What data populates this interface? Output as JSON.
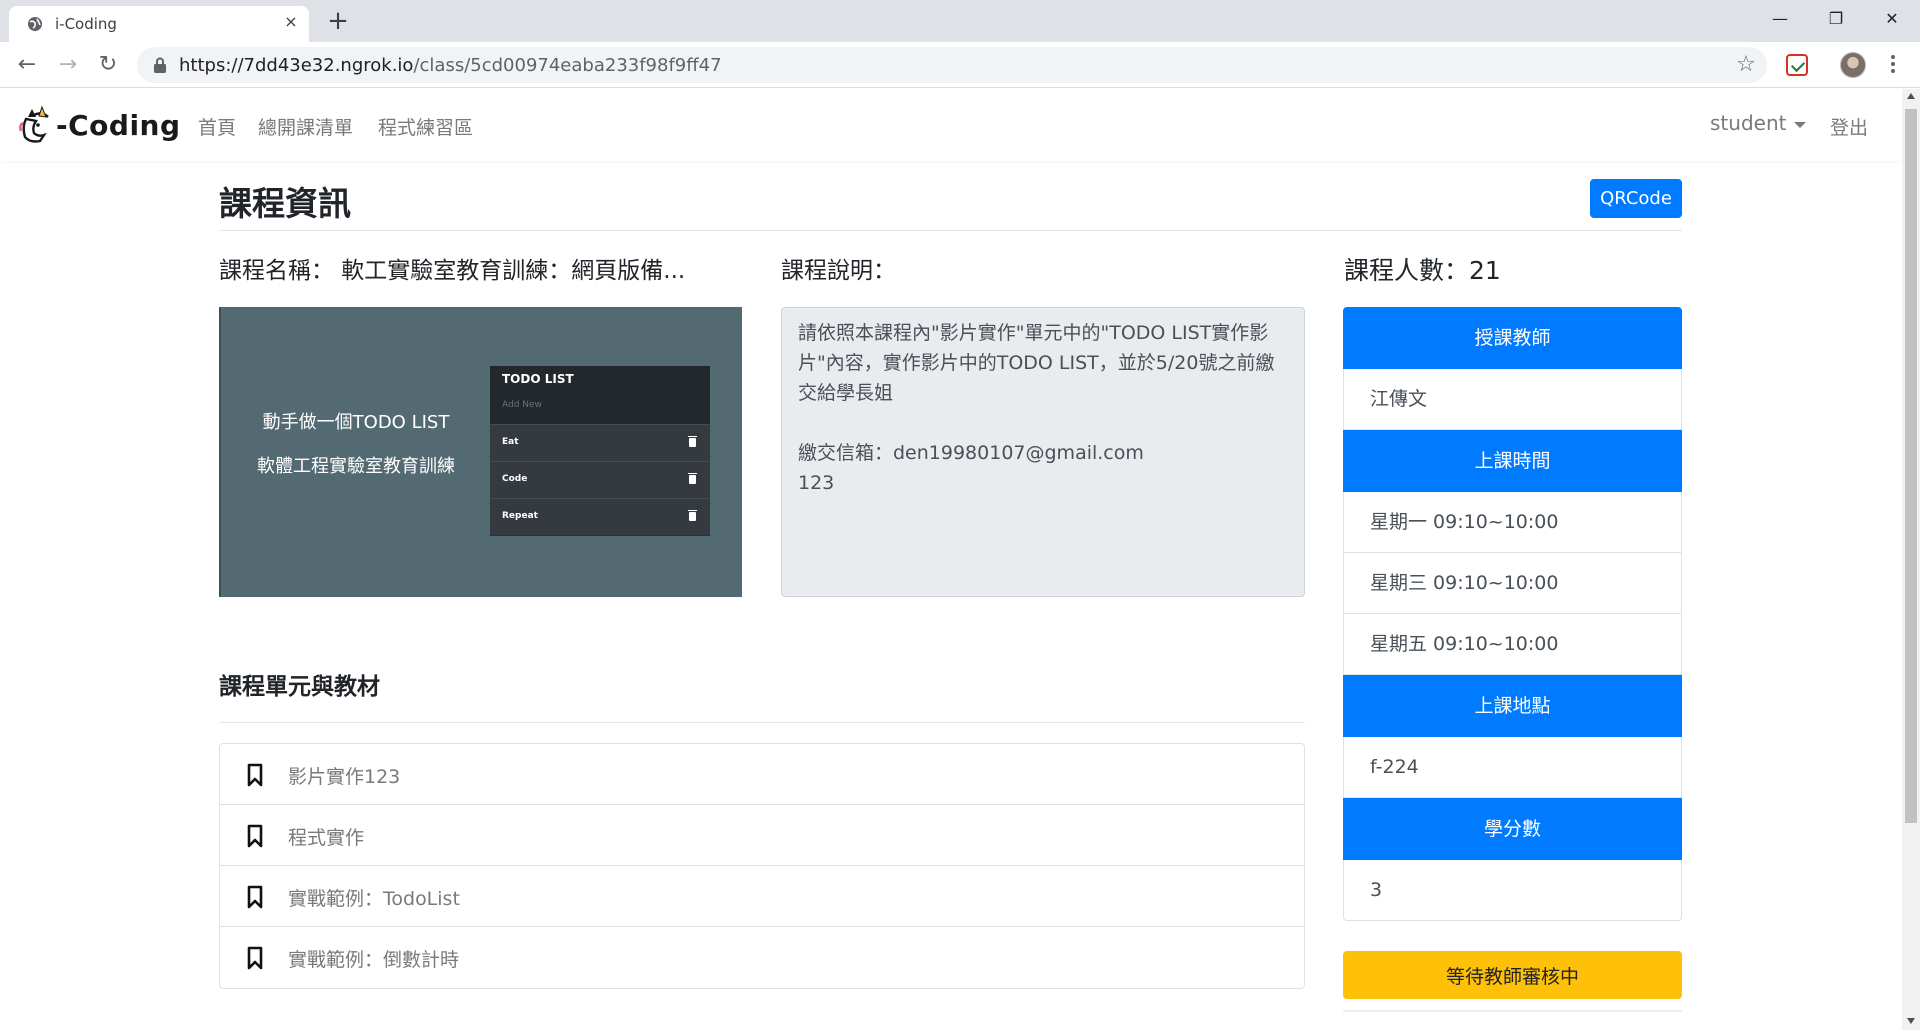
{
  "browser": {
    "tab_title": "i-Coding",
    "tab_close": "×",
    "new_tab": "+",
    "url_host": "https://7dd43e32.ngrok.io",
    "url_path": "/class/5cd00974eaba233f98f9ff47",
    "window_controls": {
      "minimize": "—",
      "maximize": "❐",
      "close": "✕"
    },
    "nav": {
      "back": "←",
      "forward": "→",
      "reload": "↻"
    },
    "star": "☆"
  },
  "navbar": {
    "brand": "-Coding",
    "links": [
      "首頁",
      "總開課清單",
      "程式練習區"
    ],
    "user": "student",
    "logout": "登出"
  },
  "header": {
    "title": "課程資訊",
    "qrcode_button": "QRCode"
  },
  "course": {
    "name_label": "課程名稱： 軟工實驗室教育訓練：網頁版備...",
    "desc_label": "課程說明：",
    "count_label": "課程人數：21",
    "image": {
      "line1": "動手做一個TODO LIST",
      "line2": "軟體工程實驗室教育訓練",
      "todo_title": "TODO LIST",
      "todo_placeholder": "Add New",
      "todo_items": [
        "Eat",
        "Code",
        "Repeat"
      ]
    },
    "description": {
      "paragraph1": "請依照本課程內\"影片實作\"單元中的\"TODO LIST實作影片\"內容，實作影片中的TODO LIST，並於5/20號之前繳交給學長姐",
      "paragraph2": "繳交信箱：den19980107@gmail.com",
      "paragraph3": "123"
    }
  },
  "sidebar": {
    "teacher_head": "授課教師",
    "teacher": "江傳文",
    "time_head": "上課時間",
    "times": [
      "星期一 09:10~10:00",
      "星期三 09:10~10:00",
      "星期五 09:10~10:00"
    ],
    "location_head": "上課地點",
    "location": "f-224",
    "credit_head": "學分數",
    "credit": "3",
    "pending_button": "等待教師審核中"
  },
  "units": {
    "title": "課程單元與教材",
    "items": [
      "影片實作123",
      "程式實作",
      "實戰範例：TodoList",
      "實戰範例：倒數計時"
    ]
  },
  "colors": {
    "primary": "#007bff",
    "warning": "#ffc107",
    "image_bg": "#546a73"
  }
}
